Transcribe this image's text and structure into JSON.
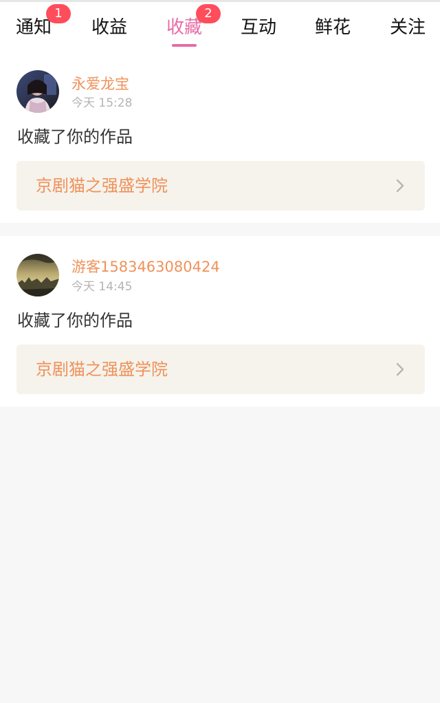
{
  "tabs": [
    {
      "label": "通知",
      "badge": "1",
      "active": false
    },
    {
      "label": "收益",
      "badge": null,
      "active": false
    },
    {
      "label": "收藏",
      "badge": "2",
      "active": true
    },
    {
      "label": "互动",
      "badge": null,
      "active": false
    },
    {
      "label": "鲜花",
      "badge": null,
      "active": false
    },
    {
      "label": "关注",
      "badge": null,
      "active": false
    }
  ],
  "notifications": [
    {
      "username": "永爱龙宝",
      "time": "今天 15:28",
      "action": "收藏了你的作品",
      "work_title": "京剧猫之强盛学院",
      "avatar_icon": "user-photo-avatar"
    },
    {
      "username": "游客1583463080424",
      "time": "今天 14:45",
      "action": "收藏了你的作品",
      "work_title": "京剧猫之强盛学院",
      "avatar_icon": "landscape-photo-avatar"
    }
  ],
  "colors": {
    "accent": "#e86ca6",
    "badge": "#ff4d5b",
    "username": "#f0915a",
    "link_bg": "#f5f3ec"
  }
}
